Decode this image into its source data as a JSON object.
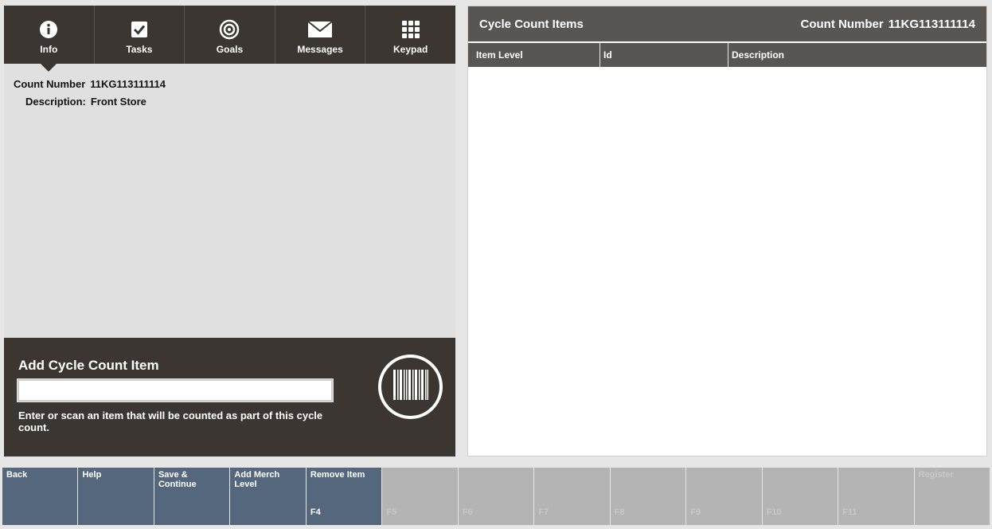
{
  "nav": {
    "tabs": [
      {
        "label": "Info",
        "icon": "info-icon"
      },
      {
        "label": "Tasks",
        "icon": "checkbox-icon"
      },
      {
        "label": "Goals",
        "icon": "target-icon"
      },
      {
        "label": "Messages",
        "icon": "envelope-icon"
      },
      {
        "label": "Keypad",
        "icon": "keypad-grid-icon"
      }
    ],
    "active": "Info"
  },
  "info": {
    "count_number_label": "Count Number",
    "count_number_value": "11KG113111114",
    "description_label": "Description:",
    "description_value": "Front Store"
  },
  "add_item": {
    "title": "Add Cycle Count Item",
    "input_value": "",
    "hint": "Enter or scan an item that will be counted as part of this cycle count.",
    "scan_icon": "barcode-icon"
  },
  "right_panel": {
    "title": "Cycle Count Items",
    "count_label": "Count Number",
    "count_value": "11KG113111114",
    "columns": [
      "Item Level",
      "Id",
      "Description"
    ],
    "rows": []
  },
  "function_keys": [
    {
      "label": "Back",
      "code": "",
      "enabled": true
    },
    {
      "label": "Help",
      "code": "",
      "enabled": true
    },
    {
      "label": "Save & Continue",
      "code": "",
      "enabled": true
    },
    {
      "label": "Add Merch Level",
      "code": "",
      "enabled": true
    },
    {
      "label": "Remove Item",
      "code": "F4",
      "enabled": true
    },
    {
      "label": "",
      "code": "F5",
      "enabled": false
    },
    {
      "label": "",
      "code": "F6",
      "enabled": false
    },
    {
      "label": "",
      "code": "F7",
      "enabled": false
    },
    {
      "label": "",
      "code": "F8",
      "enabled": false
    },
    {
      "label": "",
      "code": "F9",
      "enabled": false
    },
    {
      "label": "",
      "code": "F10",
      "enabled": false
    },
    {
      "label": "",
      "code": "F11",
      "enabled": false
    },
    {
      "label": "Register",
      "code": "",
      "enabled": false
    }
  ],
  "colors": {
    "dark_panel": "#3b3631",
    "header_gray": "#585552",
    "fkey_active": "#54677c",
    "fkey_disabled": "#b4b4b4"
  }
}
